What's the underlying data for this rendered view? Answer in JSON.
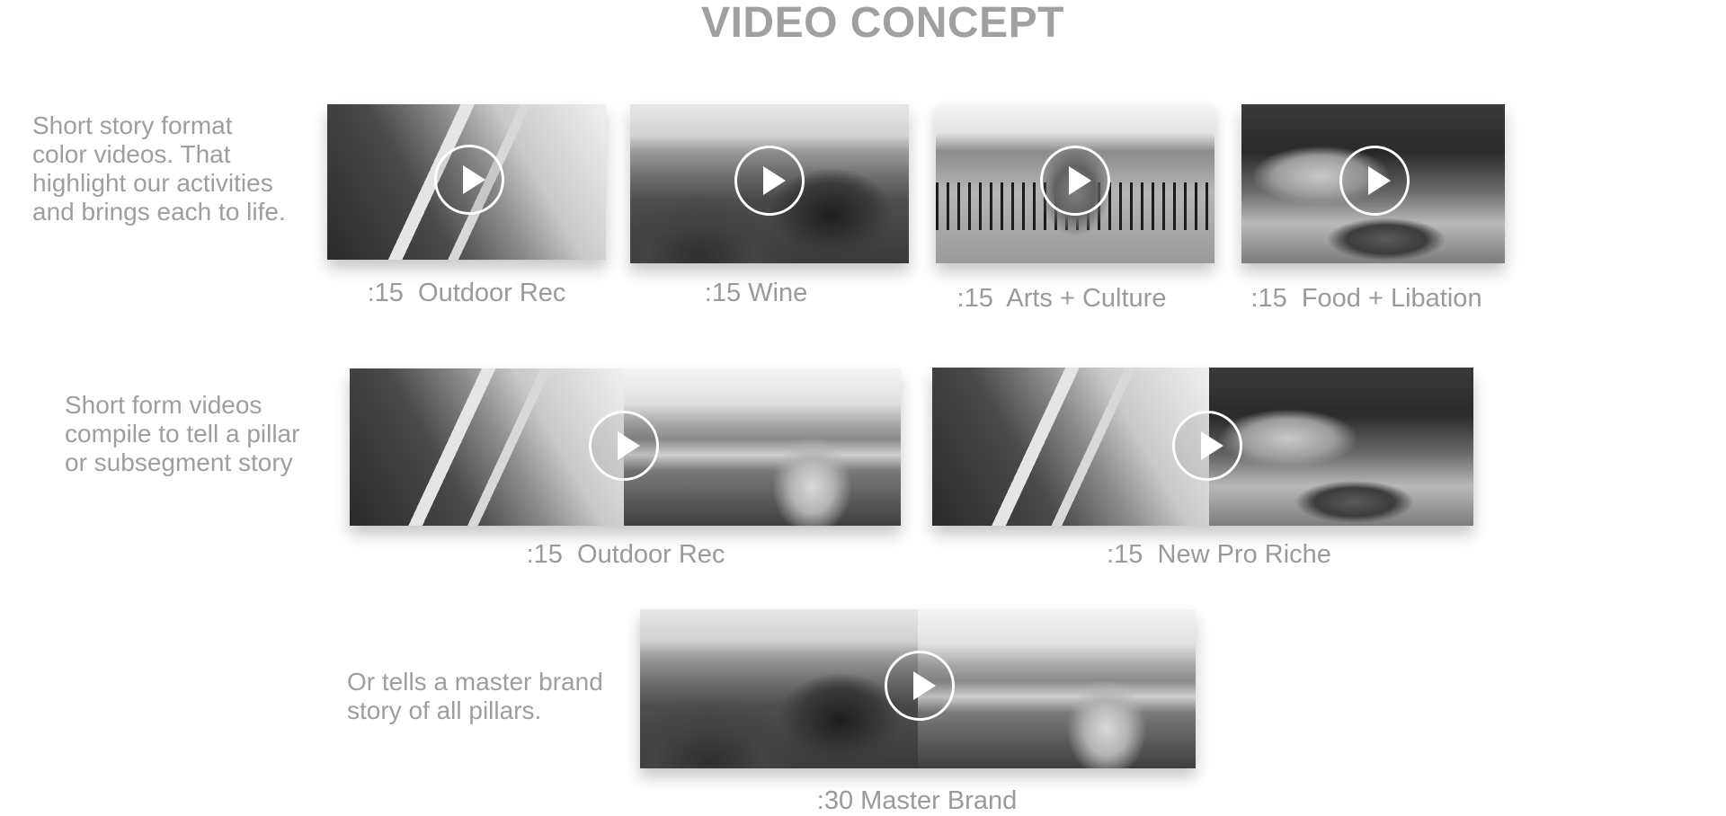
{
  "page": {
    "title": "VIDEO CONCEPT"
  },
  "rows": {
    "row1": {
      "description": [
        "Short story format",
        "color videos. That",
        "highlight our activities",
        "and brings each to life."
      ],
      "videos": [
        {
          "caption": ":15  Outdoor Rec"
        },
        {
          "caption": ":15 Wine"
        },
        {
          "caption": ":15  Arts + Culture"
        },
        {
          "caption": ":15  Food + Libation"
        }
      ]
    },
    "row2": {
      "description": [
        "Short form videos",
        "compile to tell a pillar",
        "or subsegment story"
      ],
      "videos": [
        {
          "caption": ":15  Outdoor Rec"
        },
        {
          "caption": ":15  New Pro Riche"
        }
      ]
    },
    "row3": {
      "description": [
        "Or tells a master brand",
        "story of all pillars."
      ],
      "videos": [
        {
          "caption": ":30 Master Brand"
        }
      ]
    }
  },
  "icons": {
    "play": "play-icon"
  }
}
